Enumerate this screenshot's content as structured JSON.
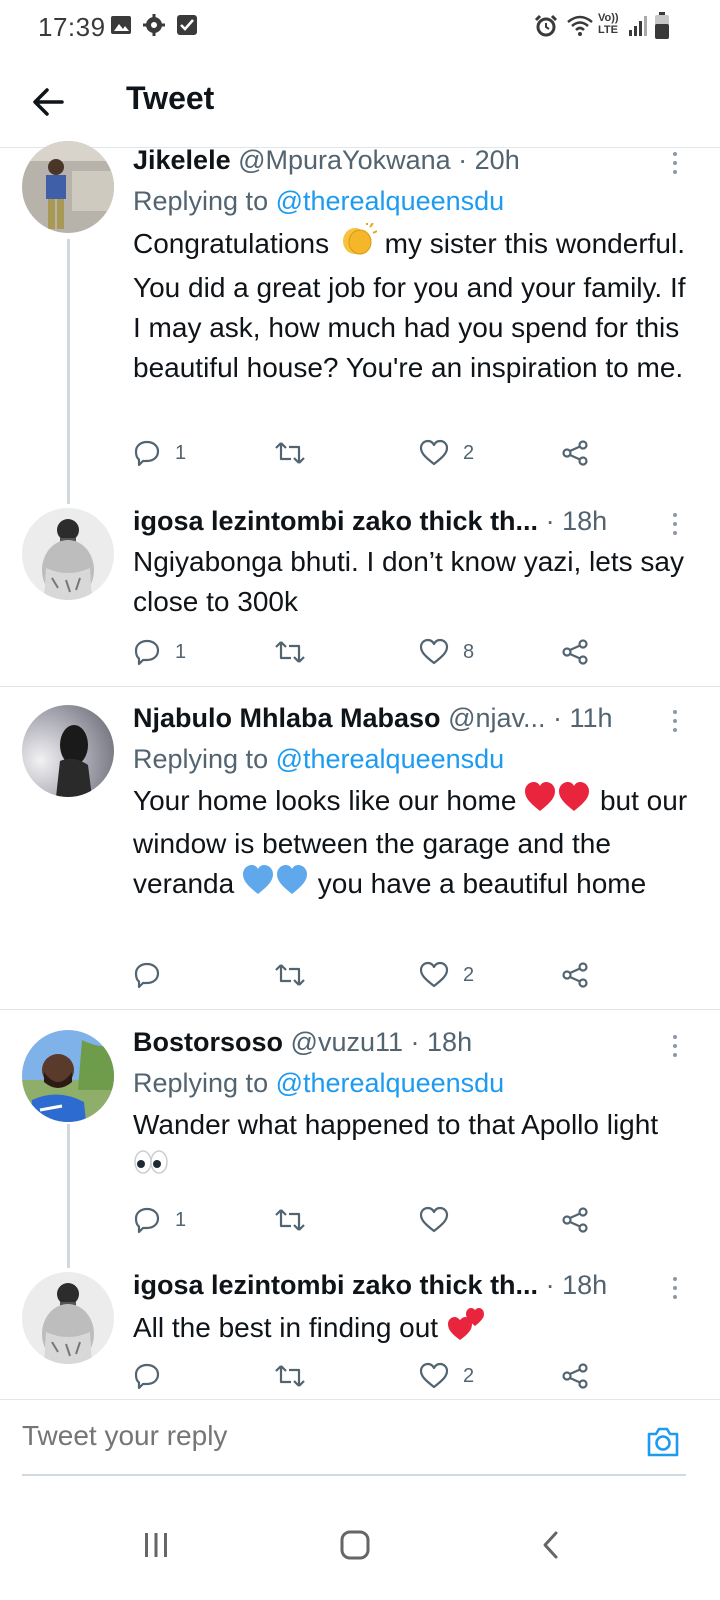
{
  "status_bar": {
    "time": "17:39",
    "icons_left": [
      "gallery-icon",
      "gear-icon",
      "checkbox-icon"
    ],
    "icons_right": [
      "alarm-icon",
      "wifi-icon",
      "volte-icon",
      "signal-icon",
      "battery-icon"
    ],
    "volte_label": "Vo)) LTE"
  },
  "header": {
    "title": "Tweet",
    "back_icon": "arrow-left-icon"
  },
  "tweets": [
    {
      "name": "Jikelele",
      "handle": "@MpuraYokwana",
      "time": "· 20h",
      "replying_prefix": "Replying to ",
      "replying_to": "@therealqueensdu",
      "text_before": "Congratulations ",
      "emoji": "👏",
      "text_after": " my sister this wonderful. You did a great job for you and your family. If I may ask, how much had you spend for this beautiful house? You're an inspiration to me.",
      "replies": "1",
      "retweets": "",
      "likes": "2"
    },
    {
      "name": "igosa lezintombi zako thick th...",
      "handle": "",
      "time": "· 18h",
      "text": "Ngiyabonga bhuti. I don’t know yazi, lets say close to 300k",
      "replies": "1",
      "retweets": "",
      "likes": "8"
    },
    {
      "name": "Njabulo Mhlaba Mabaso",
      "handle": "@njav...",
      "time": "· 11h",
      "replying_prefix": "Replying to ",
      "replying_to": "@therealqueensdu",
      "text_part1": "Your home looks like our home ",
      "text_part2": " but our window is between the garage and the veranda ",
      "text_part3": " you have a beautiful home",
      "replies": "",
      "retweets": "",
      "likes": "2"
    },
    {
      "name": "Bostorsoso",
      "handle": "@vuzu11",
      "time": "· 18h",
      "replying_prefix": "Replying to ",
      "replying_to": "@therealqueensdu",
      "text": "Wander what happened to that Apollo light ",
      "emoji": "👀",
      "replies": "1",
      "retweets": "",
      "likes": ""
    },
    {
      "name": "igosa lezintombi zako thick th...",
      "handle": "",
      "time": "· 18h",
      "text": "All the best in finding out ",
      "emoji": "💕",
      "replies": "",
      "retweets": "",
      "likes": "2"
    }
  ],
  "reply_bar": {
    "placeholder": "Tweet your reply",
    "camera_icon": "camera-icon"
  },
  "nav_bar": {
    "items": [
      "recent-apps-icon",
      "home-icon",
      "back-icon"
    ]
  },
  "colors": {
    "accent": "#1d9bf0",
    "text": "#0f1419",
    "secondary": "#536471",
    "heart_red": "#e8253d",
    "heart_blue": "#5fa8ec"
  }
}
